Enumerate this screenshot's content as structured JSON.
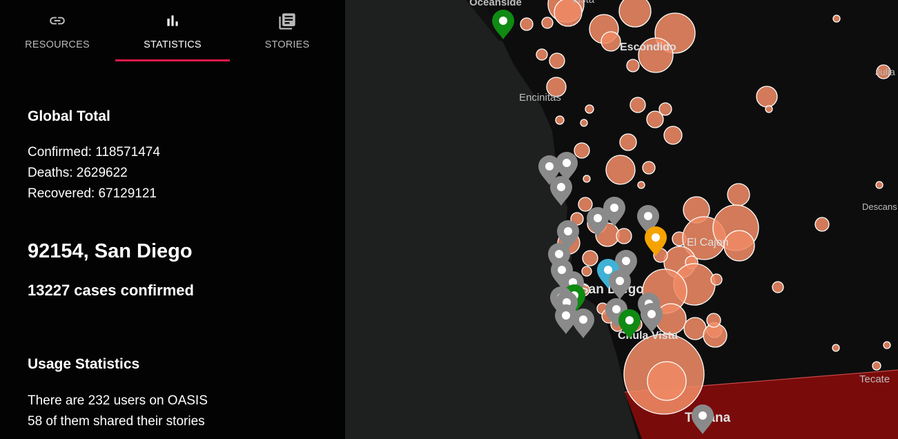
{
  "tabs": [
    {
      "label": "RESOURCES",
      "icon": "link-icon",
      "active": false
    },
    {
      "label": "STATISTICS",
      "icon": "bar-chart-icon",
      "active": true
    },
    {
      "label": "STORIES",
      "icon": "library-books-icon",
      "active": false
    }
  ],
  "global": {
    "title": "Global Total",
    "confirmed": "Confirmed: 118571474",
    "deaths": "Deaths: 2629622",
    "recovered": "Recovered: 67129121"
  },
  "location": {
    "title": "92154, San Diego",
    "cases": "13227 cases confirmed"
  },
  "usage": {
    "title": "Usage Statistics",
    "users": "There are 232 users on OASIS",
    "stories": "58 of them shared their stories"
  },
  "map": {
    "places": {
      "oceanside": "Oceanside",
      "vista": "Vista",
      "escondido": "Escondido",
      "encinitas": "Encinitas",
      "julian": "Julia",
      "descanso": "Descans",
      "el_cajon": "El Cajon",
      "san_diego": "San Diego",
      "chula_vista": "Chula Vista",
      "tecate": "Tecate",
      "tijuana": "Tijuana"
    },
    "colors": {
      "water": "#1e1f1f",
      "land": "#0d0d0d",
      "case_circle": "#ee8a64",
      "mexico": "#7a0b0b",
      "pin_grey": "#8a8a8a",
      "pin_green": "#0f8a12",
      "pin_orange": "#f5a300",
      "pin_blue": "#3fb2d6"
    }
  }
}
